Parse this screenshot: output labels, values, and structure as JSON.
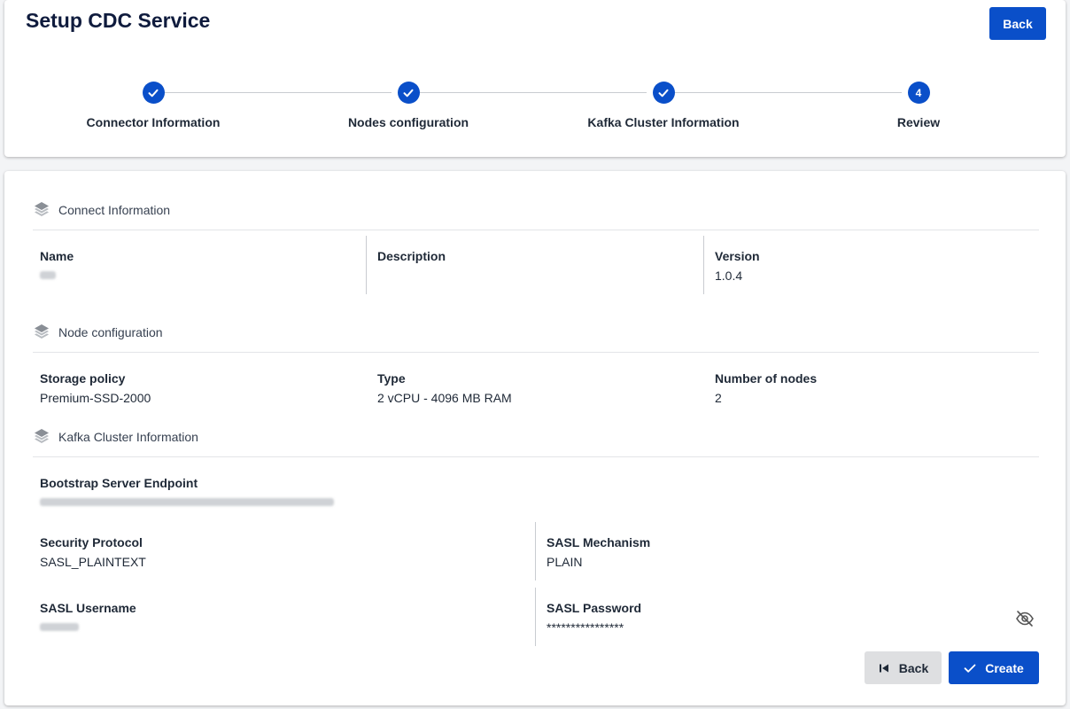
{
  "header": {
    "title": "Setup CDC Service",
    "back_label": "Back"
  },
  "stepper": {
    "steps": [
      {
        "label": "Connector Information",
        "status": "done"
      },
      {
        "label": "Nodes configuration",
        "status": "done"
      },
      {
        "label": "Kafka Cluster Information",
        "status": "done"
      },
      {
        "label": "Review",
        "status": "current",
        "number": "4"
      }
    ]
  },
  "sections": {
    "connect": {
      "title": "Connect Information",
      "name_label": "Name",
      "description_label": "Description",
      "description_value": "",
      "version_label": "Version",
      "version_value": "1.0.4"
    },
    "node": {
      "title": "Node configuration",
      "storage_label": "Storage policy",
      "storage_value": "Premium-SSD-2000",
      "type_label": "Type",
      "type_value": "2 vCPU - 4096 MB RAM",
      "nodes_label": "Number of nodes",
      "nodes_value": "2"
    },
    "kafka": {
      "title": "Kafka Cluster Information",
      "bootstrap_label": "Bootstrap Server Endpoint",
      "security_label": "Security Protocol",
      "security_value": "SASL_PLAINTEXT",
      "mechanism_label": "SASL Mechanism",
      "mechanism_value": "PLAIN",
      "username_label": "SASL Username",
      "password_label": "SASL Password",
      "password_value": "****************"
    }
  },
  "footer": {
    "back_label": "Back",
    "create_label": "Create"
  },
  "colors": {
    "primary": "#0a4fc9",
    "secondary_button": "#dedfe1"
  }
}
